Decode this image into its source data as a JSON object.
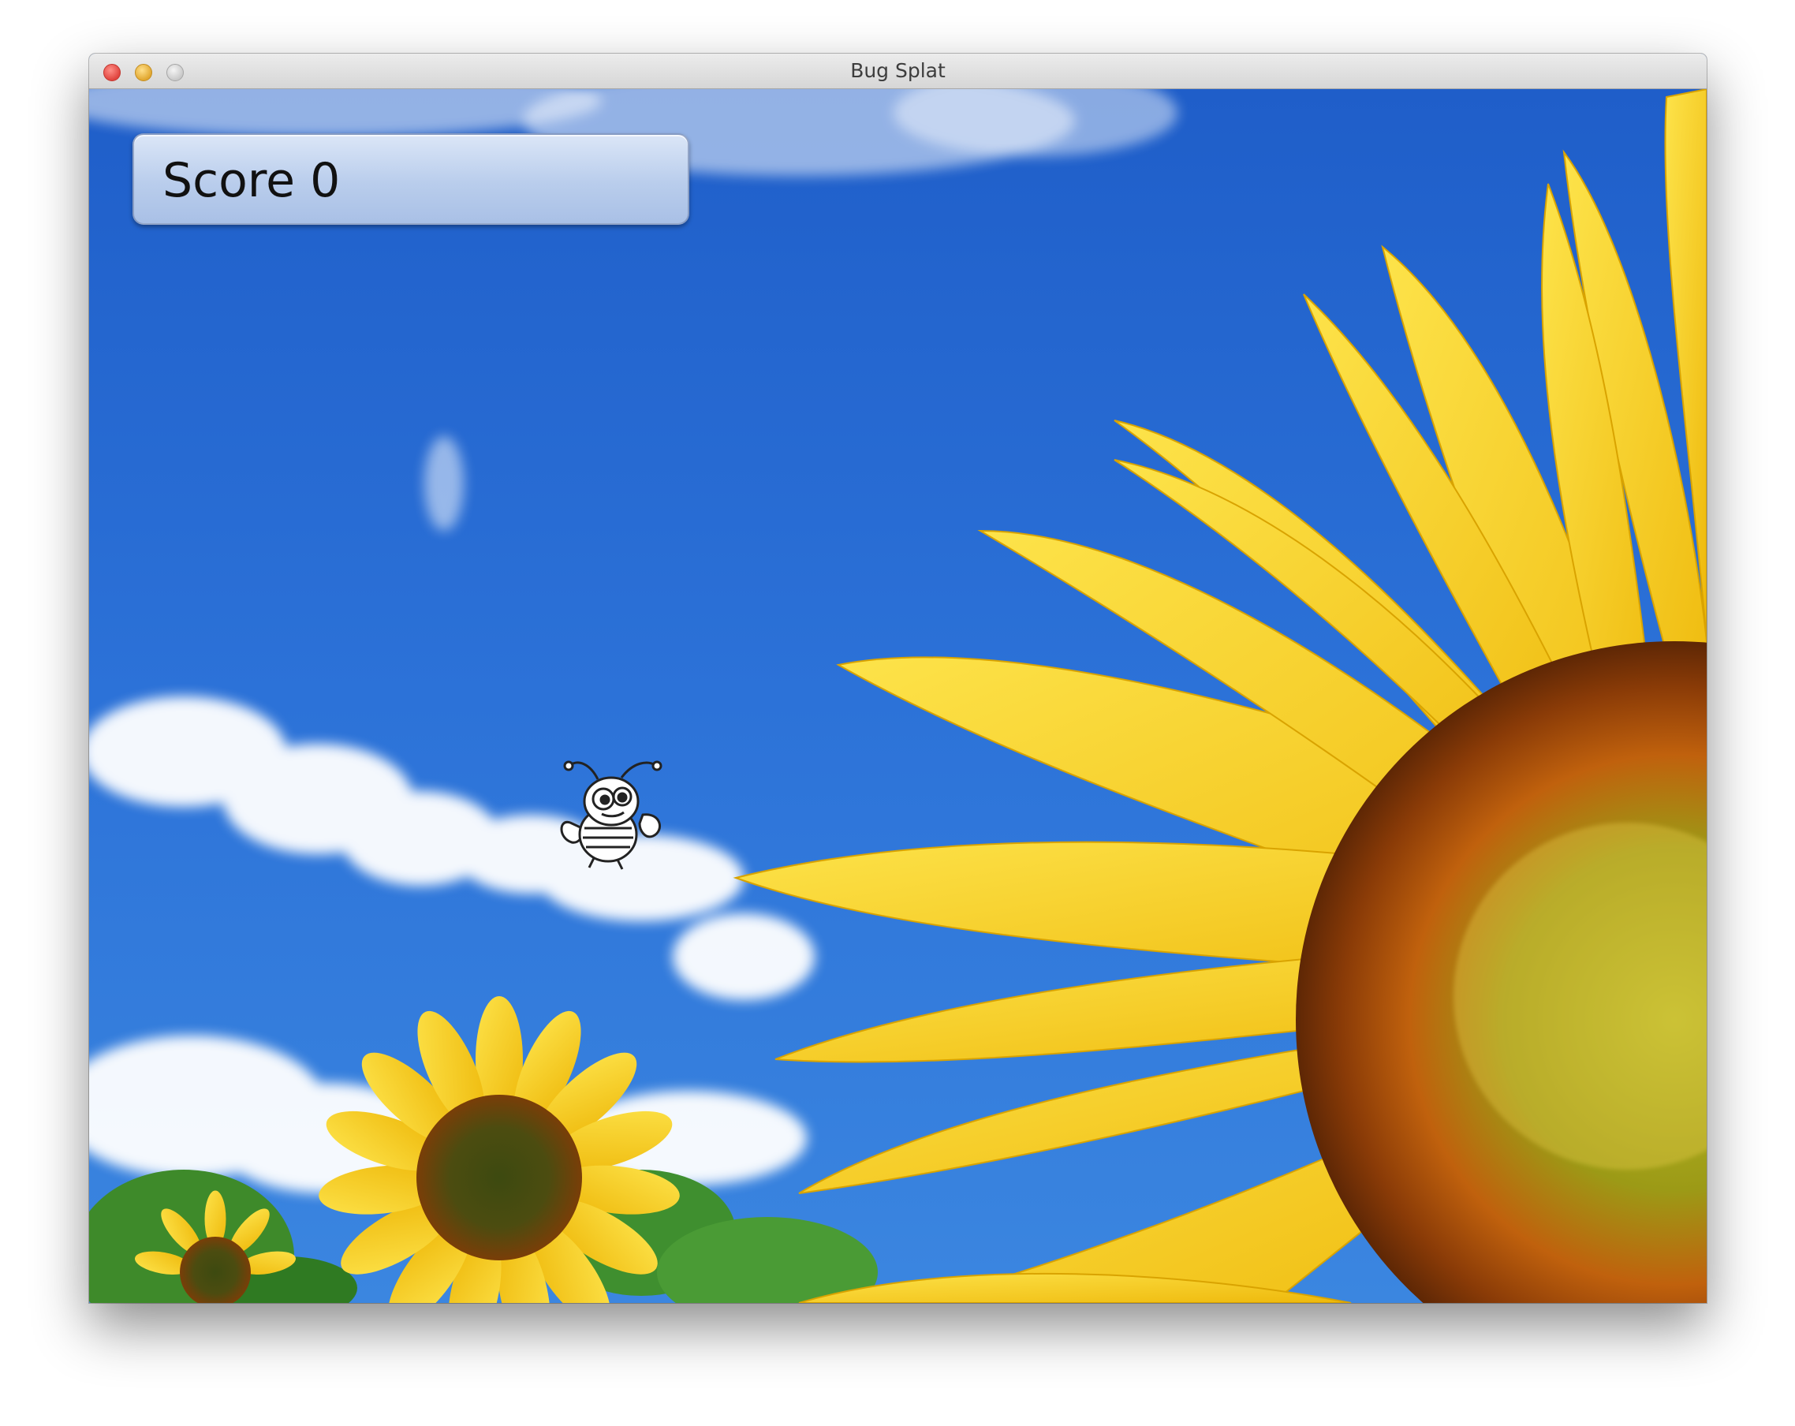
{
  "window": {
    "title": "Bug Splat"
  },
  "hud": {
    "score_label": "Score",
    "score_value": "0"
  },
  "sprites": {
    "bug": "cartoon-bug"
  },
  "colors": {
    "sky": "#2a6cd4",
    "petal": "#f7cf16",
    "seed_center": "#a8a818",
    "score_panel": "#c7d6f0"
  }
}
